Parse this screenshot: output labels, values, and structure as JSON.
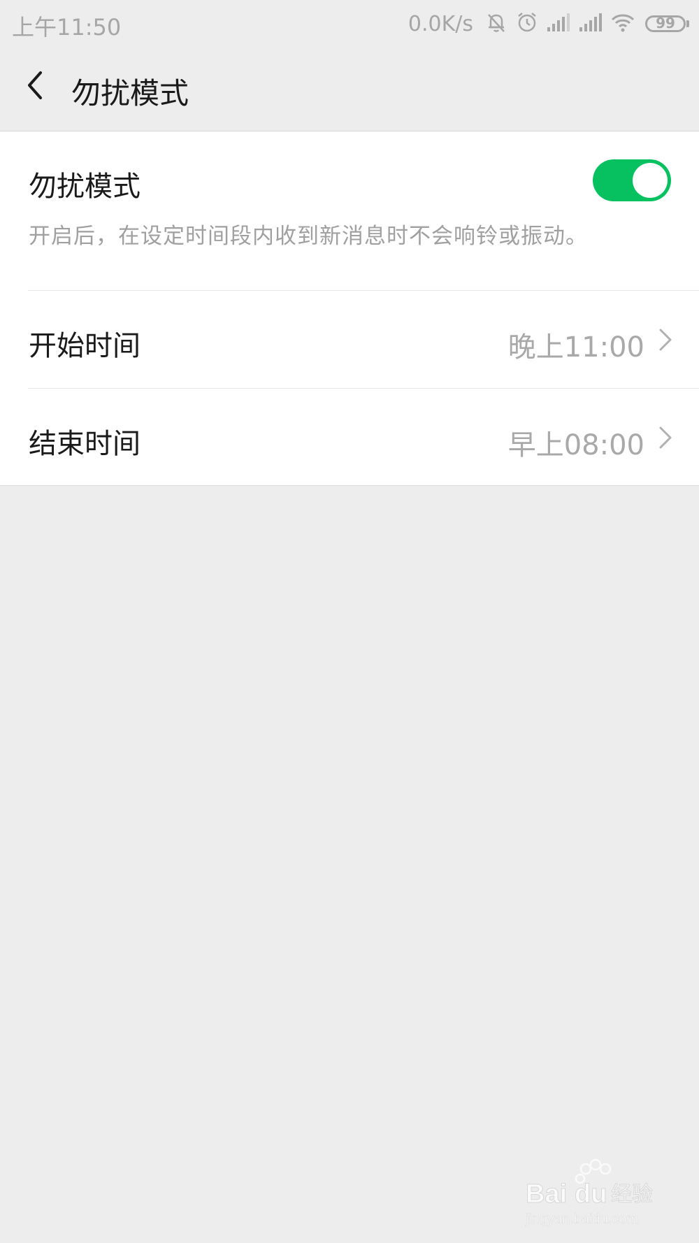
{
  "status_bar": {
    "time": "上午11:50",
    "network_speed": "0.0K/s",
    "battery_level": "99",
    "icons": [
      "mute-icon",
      "alarm-icon",
      "signal-icon",
      "signal-icon",
      "wifi-icon",
      "battery-icon"
    ]
  },
  "header": {
    "title": "勿扰模式",
    "back_icon": "back-arrow-icon"
  },
  "settings": {
    "dnd": {
      "label": "勿扰模式",
      "description": "开启后，在设定时间段内收到新消息时不会响铃或振动。",
      "enabled": true
    },
    "start_time": {
      "label": "开始时间",
      "value": "晚上11:00"
    },
    "end_time": {
      "label": "结束时间",
      "value": "早上08:00"
    }
  },
  "colors": {
    "accent": "#07c160",
    "background": "#ededed",
    "card": "#ffffff",
    "secondary_text": "#a0a0a0"
  },
  "watermark": {
    "brand": "Bai du 经验",
    "url": "jingyan.baidu.com"
  }
}
